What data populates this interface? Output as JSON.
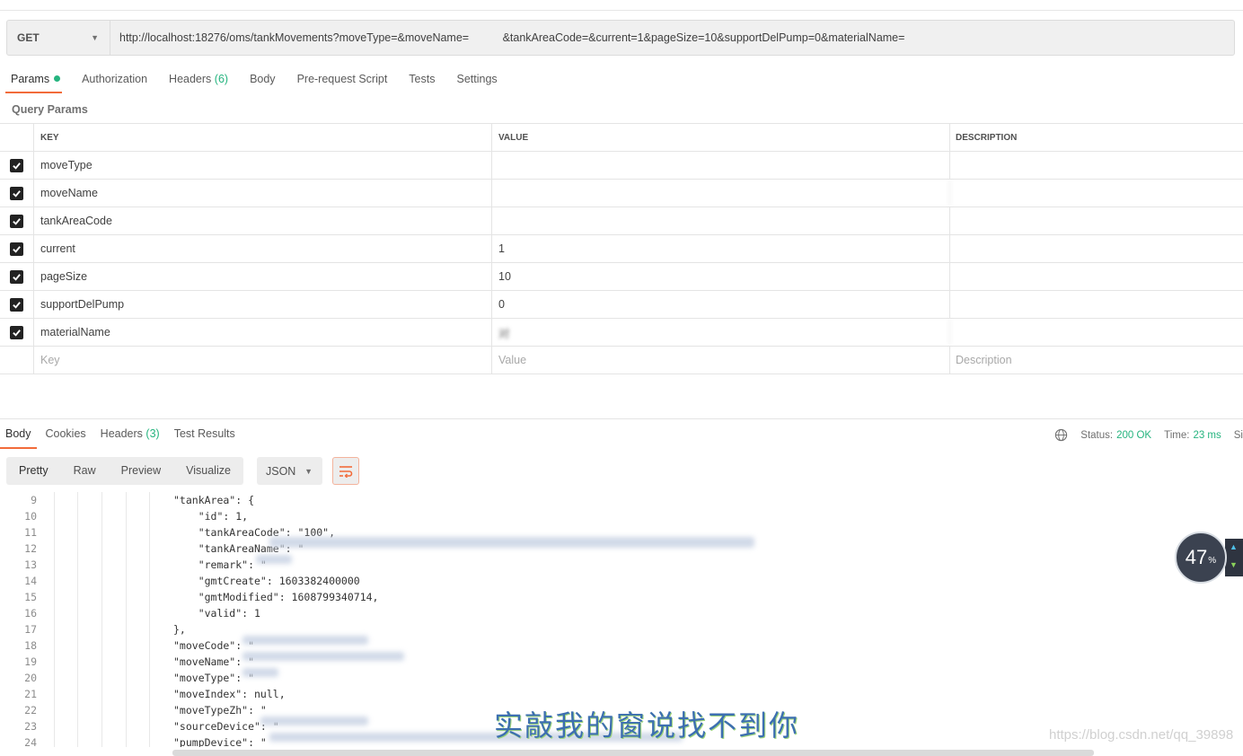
{
  "request": {
    "method": "GET",
    "url": "http://localhost:18276/oms/tankMovements?moveType=&moveName=   &tankAreaCode=&current=1&pageSize=10&supportDelPump=0&materialName=  "
  },
  "req_tabs": [
    {
      "label": "Params",
      "badge": ""
    },
    {
      "label": "Authorization",
      "badge": ""
    },
    {
      "label": "Headers",
      "badge": "(6)"
    },
    {
      "label": "Body",
      "badge": ""
    },
    {
      "label": "Pre-request Script",
      "badge": ""
    },
    {
      "label": "Tests",
      "badge": ""
    },
    {
      "label": "Settings",
      "badge": ""
    }
  ],
  "query_params_title": "Query Params",
  "params_table": {
    "headers": [
      "KEY",
      "VALUE",
      "DESCRIPTION"
    ],
    "rows": [
      {
        "key": "moveType",
        "value": "",
        "description": ""
      },
      {
        "key": "moveName",
        "value": "  ",
        "description": ""
      },
      {
        "key": "tankAreaCode",
        "value": "",
        "description": ""
      },
      {
        "key": "current",
        "value": "1",
        "description": ""
      },
      {
        "key": "pageSize",
        "value": "10",
        "description": ""
      },
      {
        "key": "supportDelPump",
        "value": "0",
        "description": ""
      },
      {
        "key": "materialName",
        "value": "对  ",
        "description": ""
      }
    ],
    "placeholders": {
      "key": "Key",
      "value": "Value",
      "description": "Description"
    }
  },
  "resp_tabs": [
    {
      "label": "Body",
      "badge": ""
    },
    {
      "label": "Cookies",
      "badge": ""
    },
    {
      "label": "Headers",
      "badge": "(3)"
    },
    {
      "label": "Test Results",
      "badge": ""
    }
  ],
  "status": {
    "status_label": "Status:",
    "status_value": "200 OK",
    "time_label": "Time:",
    "time_value": "23 ms",
    "size_label": "Si"
  },
  "view_modes": [
    "Pretty",
    "Raw",
    "Preview",
    "Visualize"
  ],
  "format": "JSON",
  "code_lines": [
    {
      "n": "9",
      "text": "\"tankArea\": {"
    },
    {
      "n": "10",
      "text": "    \"id\": 1,"
    },
    {
      "n": "11",
      "text": "    \"tankAreaCode\": \"100\","
    },
    {
      "n": "12",
      "text": "    \"tankAreaName\": \""
    },
    {
      "n": "13",
      "text": "    \"remark\": \""
    },
    {
      "n": "14",
      "text": "    \"gmtCreate\": 1603382400000"
    },
    {
      "n": "15",
      "text": "    \"gmtModified\": 1608799340714,"
    },
    {
      "n": "16",
      "text": "    \"valid\": 1"
    },
    {
      "n": "17",
      "text": "},"
    },
    {
      "n": "18",
      "text": "\"moveCode\": \""
    },
    {
      "n": "19",
      "text": "\"moveName\": \""
    },
    {
      "n": "20",
      "text": "\"moveType\": \""
    },
    {
      "n": "21",
      "text": "\"moveIndex\": null,"
    },
    {
      "n": "22",
      "text": "\"moveTypeZh\": \""
    },
    {
      "n": "23",
      "text": "\"sourceDevice\": \""
    },
    {
      "n": "24",
      "text": "\"pumpDevice\": \""
    }
  ],
  "watermark_text": "实敲我的窗说找不到你",
  "site_watermark": "https://blog.csdn.net/qq_39898",
  "percent_widget": {
    "value": "47",
    "unit": "%"
  }
}
